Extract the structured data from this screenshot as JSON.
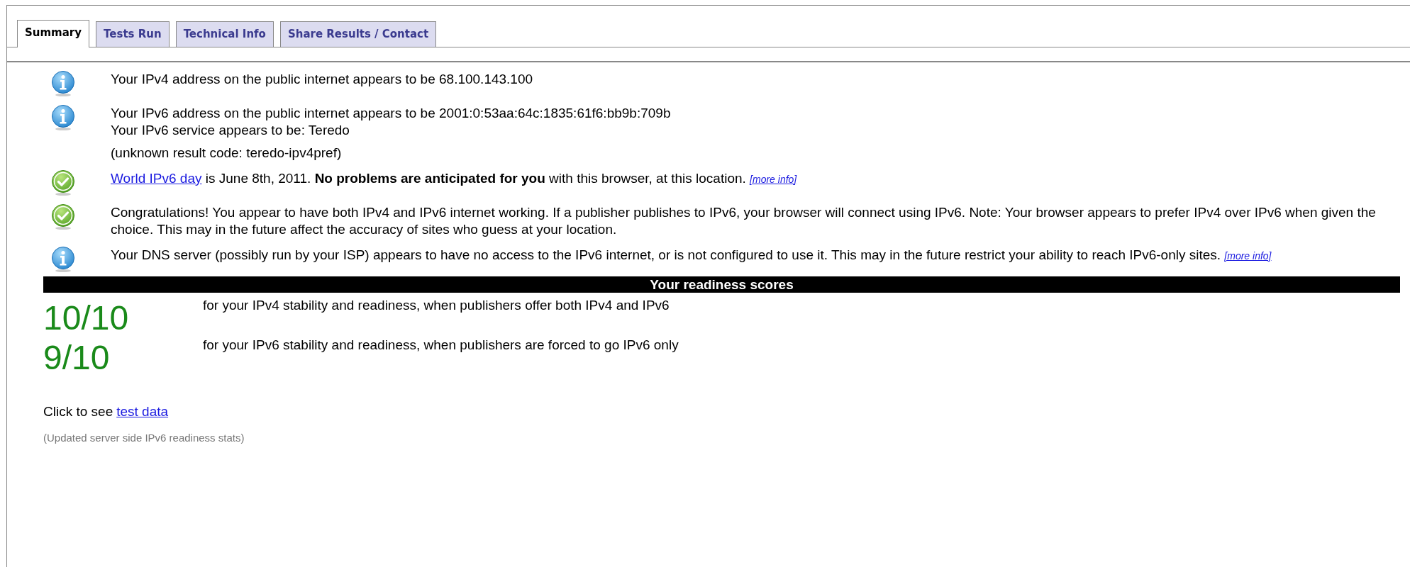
{
  "tabs": [
    {
      "label": "Summary",
      "selected": true
    },
    {
      "label": "Tests Run",
      "selected": false
    },
    {
      "label": "Technical Info",
      "selected": false
    },
    {
      "label": "Share Results / Contact",
      "selected": false
    }
  ],
  "messages": [
    {
      "kind": "info",
      "paragraphs": [
        {
          "lines": [
            {
              "text": "Your IPv4 address on the public internet appears to be 68.100.143.100"
            }
          ]
        }
      ]
    },
    {
      "kind": "info",
      "paragraphs": [
        {
          "lines": [
            {
              "text": "Your IPv6 address on the public internet appears to be 2001:0:53aa:64c:1835:61f6:bb9b:709b"
            },
            {
              "text": "Your IPv6 service appears to be: Teredo"
            }
          ]
        },
        {
          "lines": [
            {
              "text": "(unknown result code: teredo-ipv4pref)"
            }
          ]
        }
      ]
    },
    {
      "kind": "ok",
      "paragraphs": [
        {
          "lines": [
            {
              "link": "World IPv6 day",
              "text": " is June 8th, 2011. **No problems are anticipated for you** with this browser, at this location.",
              "more_info": "[more info]"
            }
          ]
        }
      ]
    },
    {
      "kind": "ok",
      "paragraphs": [
        {
          "lines": [
            {
              "text": "Congratulations! You appear to have both IPv4 and IPv6 internet working. If a publisher publishes to IPv6, your browser will connect using IPv6. Note: Your browser appears to prefer IPv4 over IPv6 when given the choice. This may in the future affect the accuracy of sites who guess at your location."
            }
          ]
        }
      ]
    },
    {
      "kind": "info",
      "paragraphs": [
        {
          "lines": [
            {
              "text": "Your DNS server (possibly run by your ISP) appears to have no access to the IPv6 internet, or is not configured to use it. This may in the future restrict your ability to reach IPv6-only sites.",
              "more_info": "[more info]"
            }
          ]
        }
      ]
    }
  ],
  "scores_title": "Your readiness scores",
  "scores": [
    {
      "score": "10/10",
      "description": "for your IPv4 stability and readiness, when publishers offer both IPv4 and IPv6"
    },
    {
      "score": "9/10",
      "description": "for your IPv6 stability and readiness, when publishers are forced to go IPv6 only"
    }
  ],
  "test_data": {
    "text": "Click to see",
    "link": "test data"
  },
  "note": "(Updated server side IPv6 readiness stats)"
}
